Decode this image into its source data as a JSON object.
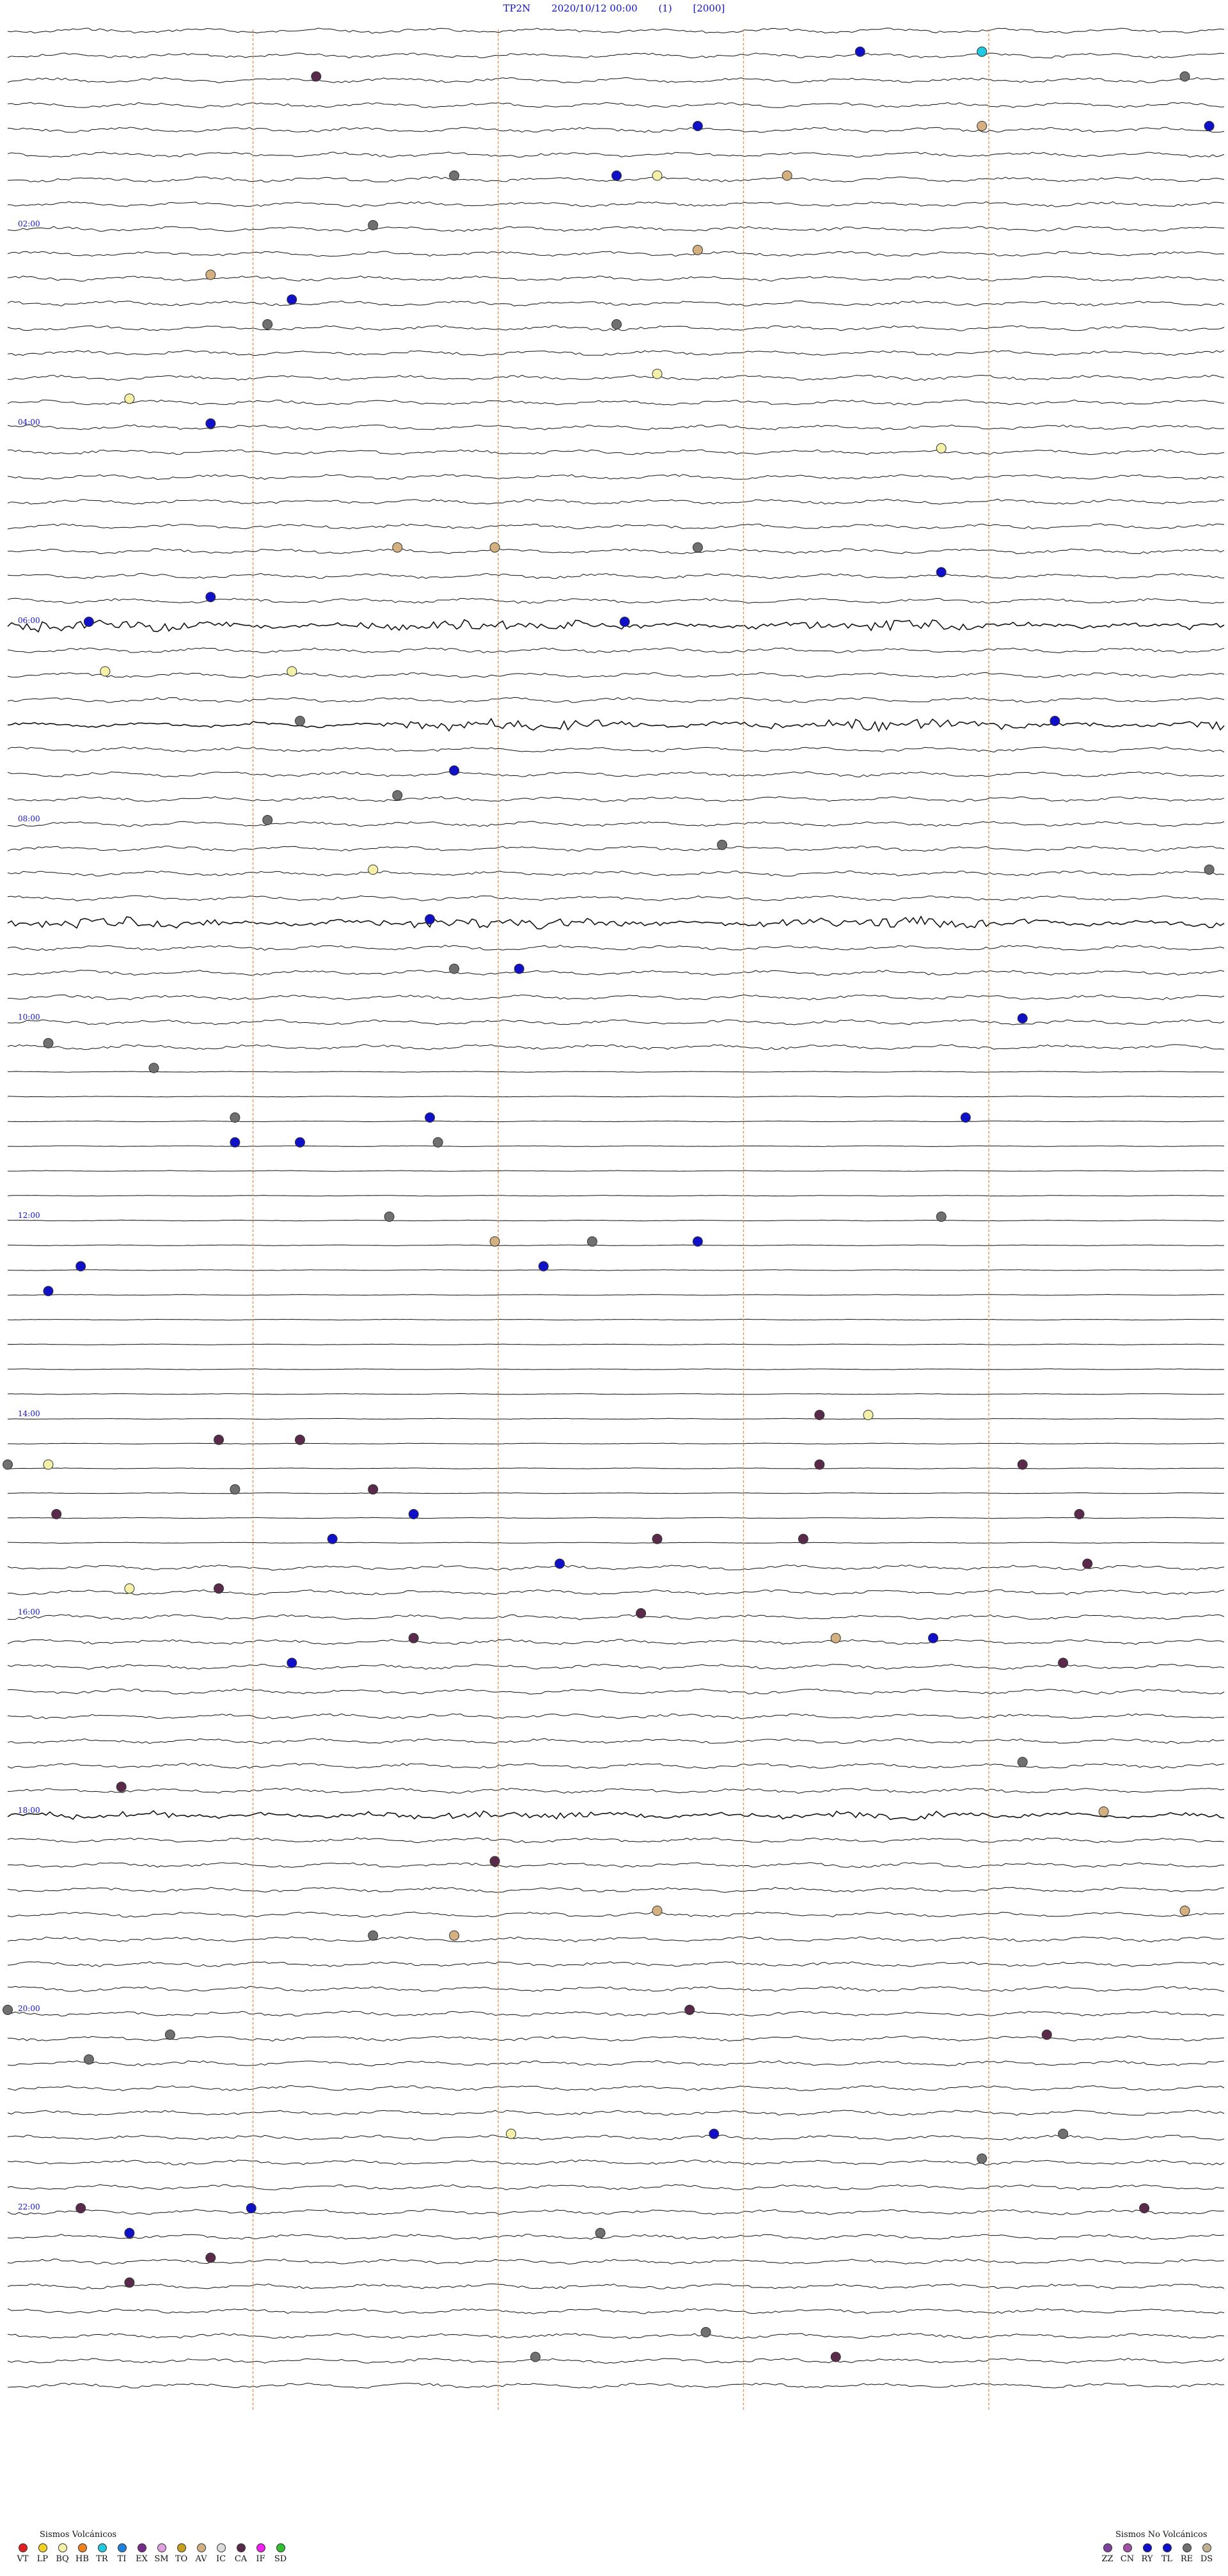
{
  "header": {
    "station": "TP2N",
    "datetime": "2020/10/12 00:00",
    "component": "(1)",
    "gain": "[2000]"
  },
  "chart_data": {
    "type": "helicorder",
    "rows_per_hour": 4,
    "minutes_per_row": 15,
    "total_hours": 24,
    "hour_labels": [
      {
        "hour": 2,
        "text": "02:00",
        "color": "#1010c8"
      },
      {
        "hour": 4,
        "text": "04:00",
        "color": "#1010c8"
      },
      {
        "hour": 6,
        "text": "06:00",
        "color": "#1010c8"
      },
      {
        "hour": 8,
        "text": "08:00",
        "color": "#1010c8"
      },
      {
        "hour": 10,
        "text": "10:00",
        "color": "#1010c8"
      },
      {
        "hour": 12,
        "text": "12:00",
        "color": "#1010c8"
      },
      {
        "hour": 14,
        "text": "14:00",
        "color": "#1010c8"
      },
      {
        "hour": 16,
        "text": "16:00",
        "color": "#1010c8"
      },
      {
        "hour": 18,
        "text": "18:00",
        "color": "#1010c8"
      },
      {
        "hour": 20,
        "text": "20:00",
        "color": "#1010c8"
      },
      {
        "hour": 22,
        "text": "22:00",
        "color": "#1010c8"
      }
    ],
    "bursts": [
      {
        "hour": 6,
        "from_min": 0,
        "to_min": 15,
        "amplitude": "high"
      },
      {
        "hour": 7,
        "from_min": 3,
        "to_min": 15,
        "amplitude": "high"
      },
      {
        "hour": 9,
        "from_min": 0,
        "to_min": 15,
        "amplitude": "high"
      },
      {
        "hour": 18,
        "from_min": 0,
        "to_min": 15,
        "amplitude": "medium"
      }
    ],
    "flat_hours_from": 10.5,
    "flat_hours_to": 15.5,
    "events": [
      {
        "hour": 0,
        "min": 44.5,
        "type": "RE"
      },
      {
        "hour": 0,
        "min": 27,
        "type": "TR"
      },
      {
        "hour": 0,
        "min": 25.5,
        "type": "TL"
      },
      {
        "hour": 0,
        "min": 33.8,
        "type": "CA"
      },
      {
        "hour": 1,
        "min": 12,
        "type": "AV"
      },
      {
        "hour": 1,
        "min": 8.5,
        "type": "TL"
      },
      {
        "hour": 1,
        "min": 37.5,
        "type": "TL"
      },
      {
        "hour": 1,
        "min": 38,
        "type": "BQ"
      },
      {
        "hour": 1,
        "min": 35.5,
        "type": "RE"
      },
      {
        "hour": 1,
        "min": 39.6,
        "type": "AV"
      },
      {
        "hour": 1,
        "min": 14.8,
        "type": "TL"
      },
      {
        "hour": 2,
        "min": 32.5,
        "type": "AV"
      },
      {
        "hour": 2,
        "min": 23.5,
        "type": "AV"
      },
      {
        "hour": 2,
        "min": 48.5,
        "type": "TL"
      },
      {
        "hour": 2,
        "min": 4.5,
        "type": "RE"
      },
      {
        "hour": 3,
        "min": 7.5,
        "type": "RE"
      },
      {
        "hour": 3,
        "min": 38,
        "type": "BQ"
      },
      {
        "hour": 3,
        "min": 46.5,
        "type": "BQ"
      },
      {
        "hour": 3,
        "min": 3.2,
        "type": "RE"
      },
      {
        "hour": 4,
        "min": 2.5,
        "type": "TL"
      },
      {
        "hour": 4,
        "min": 26.5,
        "type": "BQ"
      },
      {
        "hour": 5,
        "min": 41.5,
        "type": "TL"
      },
      {
        "hour": 5,
        "min": 47.5,
        "type": "TL"
      },
      {
        "hour": 5,
        "min": 21,
        "type": "AV"
      },
      {
        "hour": 5,
        "min": 23.5,
        "type": "RE"
      },
      {
        "hour": 5,
        "min": 19.8,
        "type": "AV"
      },
      {
        "hour": 6,
        "min": 7.6,
        "type": "TL"
      },
      {
        "hour": 6,
        "min": 33.5,
        "type": "BQ"
      },
      {
        "hour": 6,
        "min": 1,
        "type": "TL"
      },
      {
        "hour": 6,
        "min": 31.2,
        "type": "BQ"
      },
      {
        "hour": 7,
        "min": 49.8,
        "type": "RE"
      },
      {
        "hour": 7,
        "min": 3.6,
        "type": "RE"
      },
      {
        "hour": 7,
        "min": 35.5,
        "type": "TL"
      },
      {
        "hour": 7,
        "min": 12.9,
        "type": "TL"
      },
      {
        "hour": 8,
        "min": 44.8,
        "type": "RE"
      },
      {
        "hour": 8,
        "min": 34.5,
        "type": "BQ"
      },
      {
        "hour": 8,
        "min": 3.2,
        "type": "RE"
      },
      {
        "hour": 8,
        "min": 23.8,
        "type": "RE"
      },
      {
        "hour": 9,
        "min": 5.2,
        "type": "TL"
      },
      {
        "hour": 9,
        "min": 35.5,
        "type": "RE"
      },
      {
        "hour": 9,
        "min": 36.3,
        "type": "TL"
      },
      {
        "hour": 10,
        "min": 12.5,
        "type": "TL"
      },
      {
        "hour": 10,
        "min": 31.8,
        "type": "RE"
      },
      {
        "hour": 10,
        "min": 15.5,
        "type": "RE"
      },
      {
        "hour": 11,
        "min": 2.8,
        "type": "RE"
      },
      {
        "hour": 11,
        "min": 5.2,
        "type": "TL"
      },
      {
        "hour": 11,
        "min": 11.8,
        "type": "TL"
      },
      {
        "hour": 11,
        "min": 18.6,
        "type": "TL"
      },
      {
        "hour": 11,
        "min": 20.3,
        "type": "RE"
      },
      {
        "hour": 11,
        "min": 17.8,
        "type": "TL"
      },
      {
        "hour": 12,
        "min": 4.7,
        "type": "RE"
      },
      {
        "hour": 12,
        "min": 21,
        "type": "AV"
      },
      {
        "hour": 12,
        "min": 22.2,
        "type": "RE"
      },
      {
        "hour": 12,
        "min": 11.5,
        "type": "RE"
      },
      {
        "hour": 12,
        "min": 45.5,
        "type": "TL"
      },
      {
        "hour": 12,
        "min": 23.5,
        "type": "TL"
      },
      {
        "hour": 12,
        "min": 36.6,
        "type": "TL"
      },
      {
        "hour": 12,
        "min": 30.9,
        "type": "TL"
      },
      {
        "hour": 14,
        "min": 30.5,
        "type": "BQ"
      },
      {
        "hour": 14,
        "min": 47.8,
        "type": "RE"
      },
      {
        "hour": 14,
        "min": 30,
        "type": "RE"
      },
      {
        "hour": 14,
        "min": 10.6,
        "type": "BQ"
      },
      {
        "hour": 14,
        "min": 49.5,
        "type": "CA"
      },
      {
        "hour": 14,
        "min": 18.6,
        "type": "CA"
      },
      {
        "hour": 14,
        "min": 40,
        "type": "CA"
      },
      {
        "hour": 14,
        "min": 42.5,
        "type": "CA"
      },
      {
        "hour": 14,
        "min": 17.6,
        "type": "CA"
      },
      {
        "hour": 14,
        "min": 10,
        "type": "CA"
      },
      {
        "hour": 15,
        "min": 19,
        "type": "TL"
      },
      {
        "hour": 15,
        "min": 23,
        "type": "CA"
      },
      {
        "hour": 15,
        "min": 46.5,
        "type": "BQ"
      },
      {
        "hour": 15,
        "min": 47.6,
        "type": "CA"
      },
      {
        "hour": 15,
        "min": 0.6,
        "type": "CA"
      },
      {
        "hour": 15,
        "min": 24.8,
        "type": "CA"
      },
      {
        "hour": 15,
        "min": 43.3,
        "type": "CA"
      },
      {
        "hour": 15,
        "min": 5,
        "type": "TL"
      },
      {
        "hour": 15,
        "min": 36.8,
        "type": "TL"
      },
      {
        "hour": 15,
        "min": 13.2,
        "type": "CA"
      },
      {
        "hour": 16,
        "min": 25.2,
        "type": "AV"
      },
      {
        "hour": 16,
        "min": 26.4,
        "type": "TL"
      },
      {
        "hour": 16,
        "min": 7.8,
        "type": "CA"
      },
      {
        "hour": 16,
        "min": 33.5,
        "type": "TL"
      },
      {
        "hour": 16,
        "min": 43,
        "type": "CA"
      },
      {
        "hour": 16,
        "min": 20,
        "type": "CA"
      },
      {
        "hour": 17,
        "min": 46.4,
        "type": "CA"
      },
      {
        "hour": 17,
        "min": 42.5,
        "type": "RE"
      },
      {
        "hour": 18,
        "min": 13.5,
        "type": "AV"
      },
      {
        "hour": 18,
        "min": 36,
        "type": "CA"
      },
      {
        "hour": 19,
        "min": 19.5,
        "type": "RE"
      },
      {
        "hour": 19,
        "min": 20.5,
        "type": "AV"
      },
      {
        "hour": 19,
        "min": 14.5,
        "type": "AV"
      },
      {
        "hour": 19,
        "min": 8,
        "type": "AV"
      },
      {
        "hour": 20,
        "min": 17,
        "type": "RE"
      },
      {
        "hour": 20,
        "min": 0,
        "type": "RE"
      },
      {
        "hour": 20,
        "min": 31,
        "type": "RE"
      },
      {
        "hour": 20,
        "min": 8.4,
        "type": "CA"
      },
      {
        "hour": 20,
        "min": 27.8,
        "type": "CA"
      },
      {
        "hour": 21,
        "min": 28,
        "type": "RE"
      },
      {
        "hour": 21,
        "min": 42,
        "type": "RE"
      },
      {
        "hour": 21,
        "min": 21.2,
        "type": "BQ"
      },
      {
        "hour": 21,
        "min": 23.7,
        "type": "TL"
      },
      {
        "hour": 22,
        "min": 16.5,
        "type": "TL"
      },
      {
        "hour": 22,
        "min": 14,
        "type": "CA"
      },
      {
        "hour": 22,
        "min": 32.5,
        "type": "CA"
      },
      {
        "hour": 22,
        "min": 46.5,
        "type": "CA"
      },
      {
        "hour": 22,
        "min": 3,
        "type": "TL"
      },
      {
        "hour": 22,
        "min": 22.3,
        "type": "RE"
      },
      {
        "hour": 22,
        "min": 0.9,
        "type": "CA"
      },
      {
        "hour": 23,
        "min": 23.6,
        "type": "RE"
      },
      {
        "hour": 23,
        "min": 36.5,
        "type": "RE"
      },
      {
        "hour": 23,
        "min": 40.2,
        "type": "CA"
      }
    ]
  },
  "event_colors": {
    "VT": "#e02020",
    "LP": "#f2d020",
    "BQ": "#f4f0a8",
    "HB": "#f08020",
    "TR": "#20c8e0",
    "TI": "#2080e0",
    "EX": "#7a2a8a",
    "SM": "#e0a0e0",
    "TO": "#c8a020",
    "AV": "#d4b080",
    "IC": "#dcdcdc",
    "CA": "#5a2a4a",
    "IF": "#f020f0",
    "SD": "#30c030",
    "ZZ": "#8040a0",
    "CN": "#a050a0",
    "RY": "#1010c8",
    "TL": "#1010c8",
    "RE": "#707070",
    "DS": "#c0b090"
  },
  "legend_volcanic": {
    "title": "Sismos Volcánicos",
    "items": [
      "VT",
      "LP",
      "BQ",
      "HB",
      "TR",
      "TI",
      "EX",
      "SM",
      "TO",
      "AV",
      "IC",
      "CA",
      "IF",
      "SD"
    ]
  },
  "legend_nonvolcanic": {
    "title": "Sismos No Volcánicos",
    "items": [
      "ZZ",
      "CN",
      "RY",
      "TL",
      "RE",
      "DS"
    ]
  }
}
